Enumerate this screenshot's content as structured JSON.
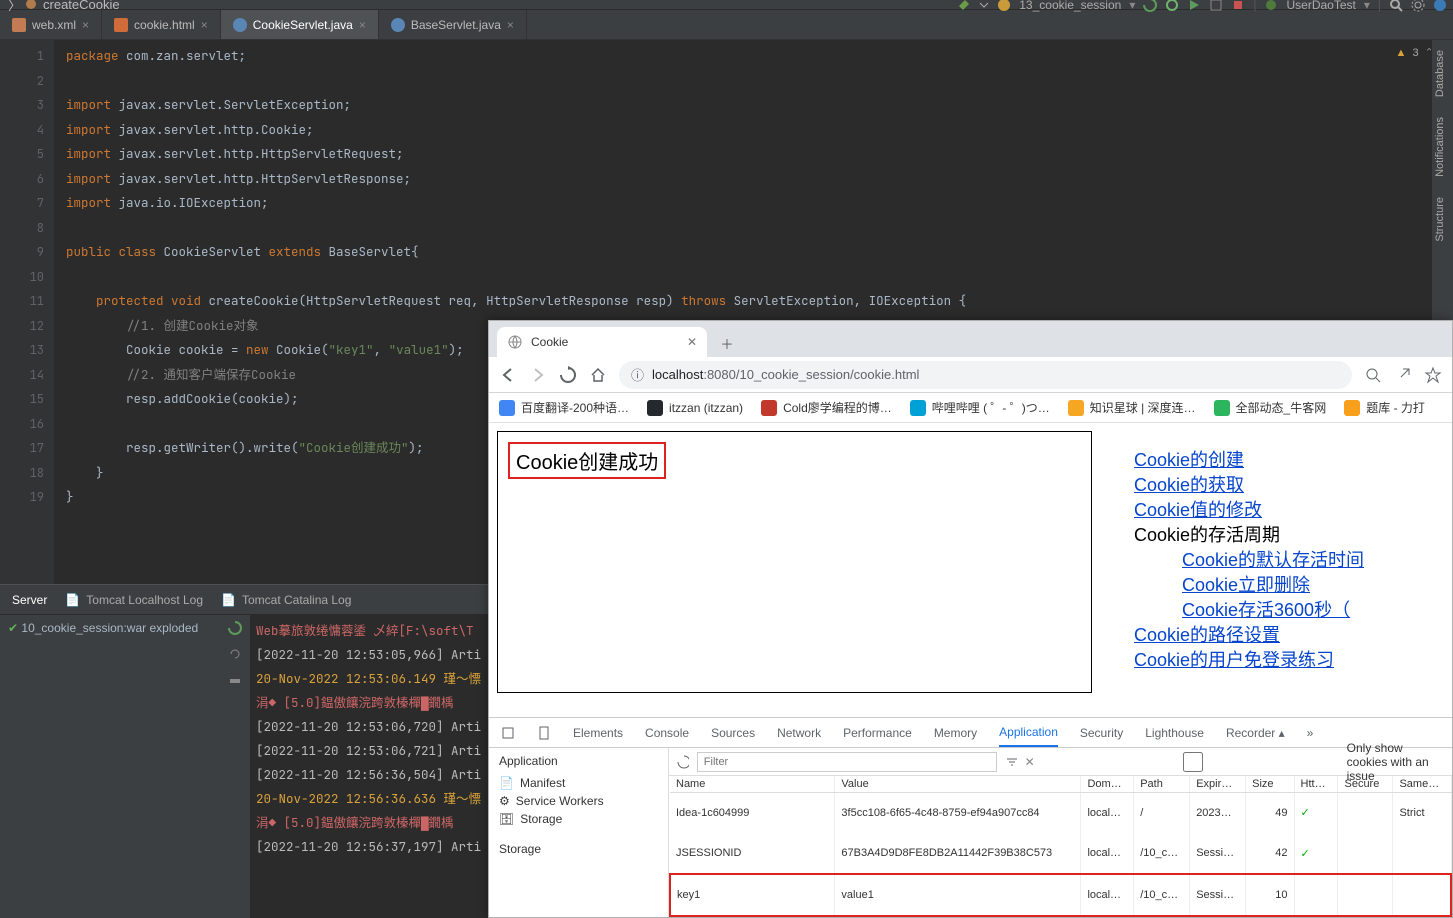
{
  "ide": {
    "breadcrumb_last": "createCookie",
    "run_config": "13_cookie_session",
    "test_target": "UserDaoTest",
    "warnings_count": "3",
    "tabs": [
      {
        "label": "web.xml",
        "type": "xml"
      },
      {
        "label": "cookie.html",
        "type": "html"
      },
      {
        "label": "CookieServlet.java",
        "type": "java",
        "active": true
      },
      {
        "label": "BaseServlet.java",
        "type": "java"
      }
    ],
    "sidebars": [
      "Database",
      "Notifications",
      "Structure"
    ],
    "bottom_tabs": [
      "Server",
      "Tomcat Localhost Log",
      "Tomcat Catalina Log"
    ],
    "deploy_item": "10_cookie_session:war exploded",
    "code": {
      "lines_total": 19,
      "l1": "package com.zan.servlet;",
      "l3": "import javax.servlet.ServletException;",
      "l4": "import javax.servlet.http.Cookie;",
      "l5": "import javax.servlet.http.HttpServletRequest;",
      "l6": "import javax.servlet.http.HttpServletResponse;",
      "l7": "import java.io.IOException;",
      "l9": "public class CookieServlet extends BaseServlet{",
      "l11": "    protected void createCookie(HttpServletRequest req, HttpServletResponse resp) throws ServletException, IOException {",
      "l12": "        //1. 创建Cookie对象",
      "l13_a": "        Cookie cookie = ",
      "l13_b": "new",
      "l13_c": " Cookie(",
      "l13_d": "\"key1\"",
      "l13_e": ", ",
      "l13_f": "\"value1\"",
      "l13_g": ");",
      "l14": "        //2. 通知客户端保存Cookie",
      "l15": "        resp.addCookie(cookie);",
      "l17_a": "        resp.getWriter().write(",
      "l17_b": "\"Cookie创建成功\"",
      "l17_c": ");",
      "l18": "    }",
      "l19": "}"
    },
    "log": [
      {
        "cls": "log-err",
        "text": "Web摹旅敦绻慵蓉鋈 乄綷[F:\\soft\\T"
      },
      {
        "cls": "log-text",
        "text": "[2022-11-20 12:53:05,966] Arti"
      },
      {
        "cls": "log-warn",
        "text": "20-Nov-2022 12:53:06.149 瑾〜慓"
      },
      {
        "cls": "log-err",
        "text": "涓◆ [5.0]鎾傲饟浣跨敦榛樿▇鐗楀"
      },
      {
        "cls": "log-text",
        "text": "[2022-11-20 12:53:06,720] Arti"
      },
      {
        "cls": "log-text",
        "text": "[2022-11-20 12:53:06,721] Arti"
      },
      {
        "cls": "log-text",
        "text": "[2022-11-20 12:56:36,504] Arti"
      },
      {
        "cls": "log-warn",
        "text": "20-Nov-2022 12:56:36.636 瑾〜慓"
      },
      {
        "cls": "log-err",
        "text": "涓◆ [5.0]鎾傲饟浣跨敦榛樿▇鐗楀"
      },
      {
        "cls": "log-text",
        "text": "[2022-11-20 12:56:37,197] Arti"
      }
    ]
  },
  "browser": {
    "tab_title": "Cookie",
    "url_host": "localhost",
    "url_port": ":8080",
    "url_path": "/10_cookie_session/cookie.html",
    "bookmarks": [
      "百度翻译-200种语…",
      "itzzan (itzzan)",
      "Cold廖学编程的博…",
      "哔哩哔哩 ( ゜- ゜)つ…",
      "知识星球 | 深度连…",
      "全部动态_牛客网",
      "题库 - 力打"
    ],
    "page": {
      "success": "Cookie创建成功",
      "links": {
        "l1": "Cookie的创建",
        "l2": "Cookie的获取",
        "l3": "Cookie值的修改",
        "l4": "Cookie的存活周期",
        "l5": "Cookie的默认存活时间",
        "l6": "Cookie立即删除",
        "l7": "Cookie存活3600秒（",
        "l8": "Cookie的路径设置",
        "l9": "Cookie的用户免登录练习"
      }
    },
    "devtools": {
      "tabs": [
        "Elements",
        "Console",
        "Sources",
        "Network",
        "Performance",
        "Memory",
        "Application",
        "Security",
        "Lighthouse",
        "Recorder ▴",
        "»"
      ],
      "active_tab": "Application",
      "side_heading": "Application",
      "side_items": [
        "Manifest",
        "Service Workers",
        "Storage"
      ],
      "side_heading2": "Storage",
      "filter_placeholder": "Filter",
      "only_issue": "Only show cookies with an issue",
      "headers": [
        "Name",
        "Value",
        "Dom…",
        "Path",
        "Expir…",
        "Size",
        "Htt…",
        "Secure",
        "Same…"
      ],
      "rows": [
        {
          "name": "Idea-1c604999",
          "value": "3f5cc108-6f65-4c48-8759-ef94a907cc84",
          "domain": "local…",
          "path": "/",
          "expires": "2023…",
          "size": "49",
          "http": "✓",
          "secure": "",
          "same": "Strict"
        },
        {
          "name": "JSESSIONID",
          "value": "67B3A4D9D8FE8DB2A11442F39B38C573",
          "domain": "local…",
          "path": "/10_c…",
          "expires": "Sessi…",
          "size": "42",
          "http": "✓",
          "secure": "",
          "same": ""
        },
        {
          "name": "key1",
          "value": "value1",
          "domain": "local…",
          "path": "/10_c…",
          "expires": "Sessi…",
          "size": "10",
          "http": "",
          "secure": "",
          "same": "",
          "highlight": true
        }
      ]
    }
  }
}
